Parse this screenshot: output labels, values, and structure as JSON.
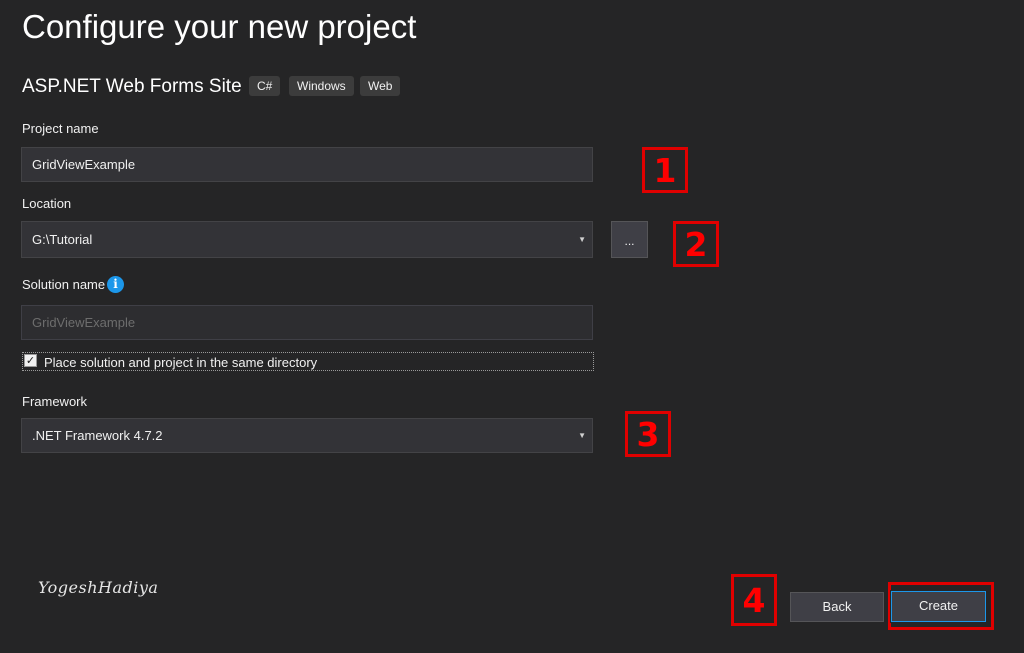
{
  "page": {
    "title": "Configure your new project",
    "template_name": "ASP.NET Web Forms Site",
    "tags": [
      "C#",
      "Windows",
      "Web"
    ]
  },
  "form": {
    "project_name": {
      "label": "Project name",
      "value": "GridViewExample"
    },
    "location": {
      "label": "Location",
      "value": "G:\\Tutorial",
      "browse_label": "..."
    },
    "solution_name": {
      "label": "Solution name",
      "value": "GridViewExample",
      "info_glyph": "i"
    },
    "same_directory": {
      "label": "Place solution and project in the same directory",
      "checked": true
    },
    "framework": {
      "label": "Framework",
      "value": ".NET Framework 4.7.2"
    }
  },
  "annotations": {
    "markers": [
      "1",
      "2",
      "3",
      "4"
    ],
    "signature": "YogeshHadiya",
    "color": "#e00000"
  },
  "buttons": {
    "back": "Back",
    "create": "Create"
  },
  "colors": {
    "background": "#252526",
    "accent": "#1c97ea",
    "field": "#333337"
  }
}
